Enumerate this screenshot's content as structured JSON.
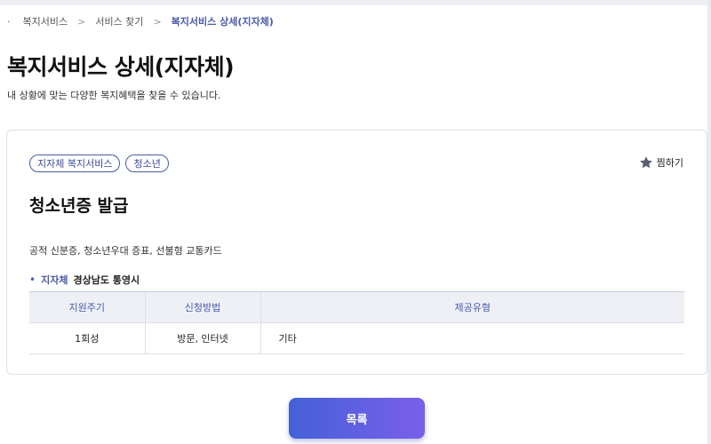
{
  "breadcrumb": {
    "bullet": "·",
    "items": [
      "복지서비스",
      "서비스 찾기",
      "복지서비스 상세(지자체)"
    ],
    "separator": ">"
  },
  "page": {
    "title": "복지서비스 상세(지자체)",
    "subtitle": "내 상황에 맞는 다양한 복지혜택을 찾을 수 있습니다."
  },
  "card": {
    "tags": [
      "지자체 복지서비스",
      "청소년"
    ],
    "favorite_label": "찜하기",
    "service_title": "청소년증 발급",
    "service_desc": "공적 신분증, 청소년우대 증표, 선불형 교통카드",
    "region": {
      "bullet": "•",
      "label": "지자체",
      "value": "경상남도 통영시"
    },
    "table": {
      "headers": [
        "지원주기",
        "신청방법",
        "제공유형"
      ],
      "row": [
        "1회성",
        "방문, 인터넷",
        "기타"
      ]
    }
  },
  "actions": {
    "list_label": "목록"
  },
  "colors": {
    "accent": "#4a5aa8",
    "button_start": "#4461d8",
    "button_end": "#7a5fe8",
    "star": "#5a5f6e"
  },
  "icons": {
    "favorite": "star-icon"
  }
}
